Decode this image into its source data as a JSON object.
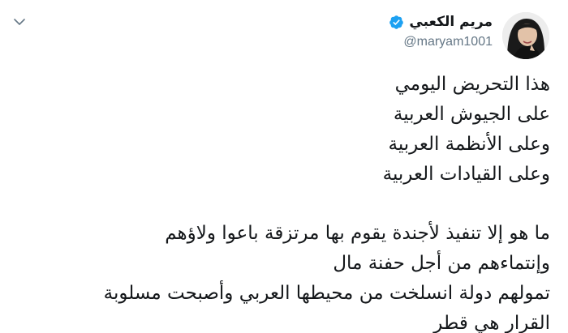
{
  "author": {
    "display_name": "مريم الكعبي",
    "handle": "@maryam1001",
    "verified": true
  },
  "icons": {
    "menu": "chevron-down-icon",
    "verified": "verified-badge-icon",
    "avatar": "avatar"
  },
  "colors": {
    "verified": "#1da1f2",
    "handle": "#657786",
    "text": "#14171a"
  },
  "tweet": {
    "paragraph_1": [
      "هذا التحريض اليومي",
      "على الجيوش العربية",
      "وعلى الأنظمة العربية",
      "وعلى القيادات العربية"
    ],
    "paragraph_2": [
      "ما هو إلا تنفيذ لأجندة يقوم بها مرتزقة باعوا  ولاؤهم",
      "وإنتماءهم من أجل حفنة مال",
      "تمولهم دولة انسلخت من محيطها العربي وأصبحت مسلوبة",
      "القرار هي قطر"
    ]
  }
}
